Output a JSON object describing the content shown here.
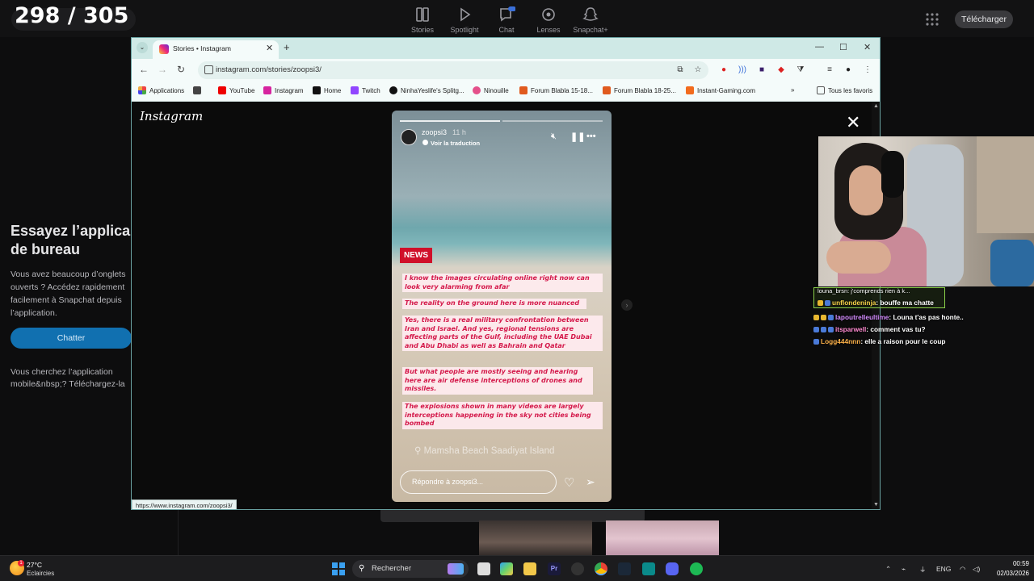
{
  "overlay": {
    "counter": "298 / 305"
  },
  "snapchat": {
    "nav": [
      {
        "label": "Stories",
        "icon": "stories-icon"
      },
      {
        "label": "Spotlight",
        "icon": "play-icon"
      },
      {
        "label": "Chat",
        "icon": "chat-icon",
        "badge": "NEW"
      },
      {
        "label": "Lenses",
        "icon": "lenses-icon"
      },
      {
        "label": "Snapchat+",
        "icon": "snapchat-plus-icon"
      }
    ],
    "download_label": "Télécharger",
    "promo": {
      "title_line1": "Essayez l’applica",
      "title_line2": "de bureau",
      "desc_lines": [
        "Vous avez beaucoup d’onglets",
        "ouverts ? Accédez rapidement",
        "facilement à Snapchat depuis",
        "l’application."
      ],
      "button": "Chatter",
      "mobile_lines": [
        "Vous cherchez l’application",
        "mobile&nbsp;? Téléchargez-la"
      ]
    }
  },
  "browser": {
    "tab_title": "Stories • Instagram",
    "url": "instagram.com/stories/zoopsi3/",
    "bookmarks": [
      {
        "label": "Applications",
        "color": "#e44"
      },
      {
        "label": "",
        "color": "#444"
      },
      {
        "label": "YouTube",
        "color": "#e00"
      },
      {
        "label": "Instagram",
        "color": "#d6249f"
      },
      {
        "label": "Home",
        "color": "#111"
      },
      {
        "label": "Twitch",
        "color": "#9146ff"
      },
      {
        "label": "NinhaYeslife's Splitg...",
        "color": "#111"
      },
      {
        "label": "Ninouille",
        "color": "#e4508a"
      },
      {
        "label": "Forum Blabla 15-18...",
        "color": "#e05a1e"
      },
      {
        "label": "Forum Blabla 18-25...",
        "color": "#e05a1e"
      },
      {
        "label": "Instant-Gaming.com",
        "color": "#f26b1d"
      }
    ],
    "all_favorites": "Tous les favoris",
    "status_url": "https://www.instagram.com/zoopsi3/"
  },
  "instagram": {
    "logo": "Instagram",
    "story": {
      "username": "zoopsi3",
      "time": "11 h",
      "translate": "Voir la traduction",
      "badge": "NEWS",
      "texts": [
        "I know the images circulating online right now can look very alarming from afar",
        "The reality on the ground here is more nuanced",
        "Yes, there is a real military confrontation between Iran and Israel. And yes, regional tensions are affecting parts of the Gulf, including the UAE Dubai and Abu Dhabi as well as Bahrain and Qatar",
        "But what people are mostly seeing and hearing here are air defense interceptions of drones and missiles.",
        "The explosions shown in many videos are largely interceptions happening in the sky not cities being bombed"
      ],
      "location": "Mamsha Beach Saadiyat Island",
      "reply_placeholder": "Répondre à zoopsi3..."
    }
  },
  "chat": [
    {
      "user": "louna_brsn",
      "message": "j'comprends rien à k...",
      "color": "#ddd"
    },
    {
      "user": "unflondeninja",
      "message": "bouffe ma chatte",
      "color": "#f7d34a"
    },
    {
      "user": "lapoutrelleultime",
      "message": "Louna t'as pas honte..",
      "color": "#d48cff"
    },
    {
      "user": "itsparwell",
      "message": "comment vas tu?",
      "color": "#ff8ad0"
    },
    {
      "user": "Logg444nnn",
      "message": "elle a raison pour le coup",
      "color": "#ffb34a"
    }
  ],
  "taskbar": {
    "weather_temp": "27°C",
    "weather_desc": "Eclaircies",
    "search_label": "Rechercher",
    "lang": "ENG",
    "time": "00:59",
    "date": "02/03/2026"
  }
}
